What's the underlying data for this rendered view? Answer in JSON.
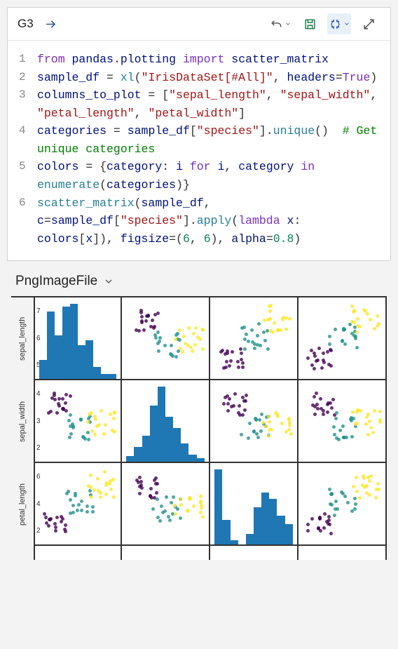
{
  "header": {
    "cell_ref": "G3",
    "icons": {
      "go": "arrow-right",
      "undo": "undo",
      "save": "save",
      "brackets": "brackets",
      "expand": "expand"
    }
  },
  "code": {
    "lines": [
      {
        "n": "1",
        "tokens": [
          [
            "kw",
            "from"
          ],
          [
            "op",
            " "
          ],
          [
            "ide",
            "pandas"
          ],
          [
            "op",
            "."
          ],
          [
            "ide",
            "plotting"
          ],
          [
            "op",
            " "
          ],
          [
            "kw",
            "import"
          ],
          [
            "op",
            " "
          ],
          [
            "ide",
            "scatter_matrix"
          ]
        ]
      },
      {
        "n": "2",
        "tokens": [
          [
            "ide",
            "sample_df"
          ],
          [
            "op",
            " = "
          ],
          [
            "fn",
            "xl"
          ],
          [
            "op",
            "("
          ],
          [
            "str",
            "\"IrisDataSet[#All]\""
          ],
          [
            "op",
            ", "
          ],
          [
            "ide",
            "headers"
          ],
          [
            "op",
            "="
          ],
          [
            "kw",
            "True"
          ],
          [
            "op",
            ")"
          ]
        ]
      },
      {
        "n": "3",
        "tokens": [
          [
            "ide",
            "columns_to_plot"
          ],
          [
            "op",
            " = ["
          ],
          [
            "str",
            "\"sepal_length\""
          ],
          [
            "op",
            ", "
          ],
          [
            "str",
            "\"sepal_width\""
          ],
          [
            "op",
            ", "
          ],
          [
            "str",
            "\"petal_length\""
          ],
          [
            "op",
            ", "
          ],
          [
            "str",
            "\"petal_width\""
          ],
          [
            "op",
            "]"
          ]
        ]
      },
      {
        "n": "4",
        "tokens": [
          [
            "ide",
            "categories"
          ],
          [
            "op",
            " = "
          ],
          [
            "ide",
            "sample_df"
          ],
          [
            "op",
            "["
          ],
          [
            "str",
            "\"species\""
          ],
          [
            "op",
            "]."
          ],
          [
            "fn",
            "unique"
          ],
          [
            "op",
            "()  "
          ],
          [
            "com",
            "# Get unique categories"
          ]
        ]
      },
      {
        "n": "5",
        "tokens": [
          [
            "ide",
            "colors"
          ],
          [
            "op",
            " = {"
          ],
          [
            "ide",
            "category"
          ],
          [
            "op",
            ": "
          ],
          [
            "ide",
            "i"
          ],
          [
            "op",
            " "
          ],
          [
            "kw",
            "for"
          ],
          [
            "op",
            " "
          ],
          [
            "ide",
            "i"
          ],
          [
            "op",
            ", "
          ],
          [
            "ide",
            "category"
          ],
          [
            "op",
            " "
          ],
          [
            "kw",
            "in"
          ],
          [
            "op",
            " "
          ],
          [
            "fn",
            "enumerate"
          ],
          [
            "op",
            "("
          ],
          [
            "ide",
            "categories"
          ],
          [
            "op",
            ")}"
          ]
        ]
      },
      {
        "n": "6",
        "tokens": [
          [
            "fn",
            "scatter_matrix"
          ],
          [
            "op",
            "("
          ],
          [
            "ide",
            "sample_df"
          ],
          [
            "op",
            ", "
          ],
          [
            "ide",
            "c"
          ],
          [
            "op",
            "="
          ],
          [
            "ide",
            "sample_df"
          ],
          [
            "op",
            "["
          ],
          [
            "str",
            "\"species\""
          ],
          [
            "op",
            "]."
          ],
          [
            "fn",
            "apply"
          ],
          [
            "op",
            "("
          ],
          [
            "kw",
            "lambda"
          ],
          [
            "op",
            " "
          ],
          [
            "ide",
            "x"
          ],
          [
            "op",
            ": "
          ],
          [
            "ide",
            "colors"
          ],
          [
            "op",
            "["
          ],
          [
            "ide",
            "x"
          ],
          [
            "op",
            "]), "
          ],
          [
            "ide",
            "figsize"
          ],
          [
            "op",
            "=("
          ],
          [
            "num",
            "6"
          ],
          [
            "op",
            ", "
          ],
          [
            "num",
            "6"
          ],
          [
            "op",
            "), "
          ],
          [
            "ide",
            "alpha"
          ],
          [
            "op",
            "="
          ],
          [
            "num",
            "0.8"
          ],
          [
            "op",
            ")"
          ]
        ]
      }
    ]
  },
  "output": {
    "title": "PngImageFile"
  },
  "chart_data": {
    "type": "scatter_matrix",
    "variables": [
      "sepal_length",
      "sepal_width",
      "petal_length",
      "petal_width"
    ],
    "visible_rows": [
      "sepal_length",
      "sepal_width",
      "petal_length"
    ],
    "color_by": "species",
    "species_colors": {
      "setosa": "#440154",
      "versicolor": "#21918c",
      "virginica": "#fde725"
    },
    "y_ticks": {
      "sepal_length": [
        5,
        6,
        7
      ],
      "sepal_width": [
        2,
        3,
        4
      ],
      "petal_length": [
        2,
        4,
        6
      ]
    },
    "diagonal_histograms": {
      "sepal_length": [
        8,
        28,
        18,
        30,
        31,
        14,
        16,
        5,
        2,
        2
      ],
      "sepal_width": [
        3,
        8,
        14,
        30,
        40,
        24,
        18,
        10,
        4,
        2
      ],
      "petal_length": [
        36,
        12,
        2,
        0,
        5,
        18,
        25,
        22,
        14,
        10
      ]
    },
    "alpha": 0.8,
    "figsize": [
      6,
      6
    ]
  }
}
